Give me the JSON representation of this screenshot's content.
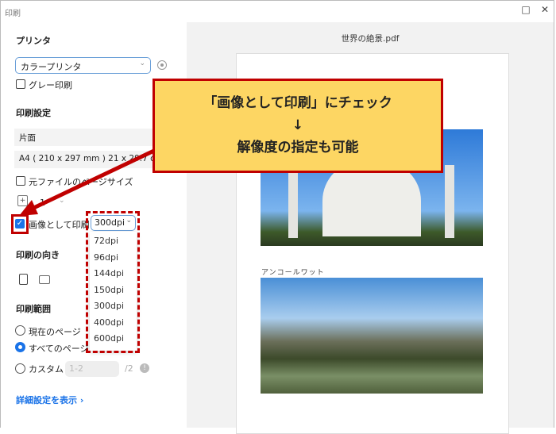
{
  "window": {
    "title": "印刷",
    "maximize_icon": "□",
    "close_icon": "✕"
  },
  "printer": {
    "heading": "プリンタ",
    "selected": "カラープリンタ",
    "gray_print": "グレー印刷"
  },
  "settings": {
    "heading": "印刷設定",
    "duplex": "片面",
    "paper": "A4 ( 210 x 297 mm ) 21 x 29.7 cm",
    "original_size": "元ファイルのページサイズ",
    "copies": "1",
    "print_as_image": "画像として印刷",
    "dpi_selected": "300dpi",
    "dpi_options": [
      "72dpi",
      "96dpi",
      "144dpi",
      "150dpi",
      "300dpi",
      "400dpi",
      "600dpi"
    ]
  },
  "orientation": {
    "heading": "印刷の向き"
  },
  "range": {
    "heading": "印刷範囲",
    "current": "現在のページ",
    "all": "すべてのページ",
    "custom": "カスタム",
    "custom_placeholder": "1-2",
    "total": "/2"
  },
  "advanced_link": "詳細設定を表示 ›",
  "preview": {
    "filename": "世界の絶景.pdf",
    "caption": "アンコールワット"
  },
  "callout": {
    "line1": "「画像として印刷」にチェック",
    "line2": "↓",
    "line3": "解像度の指定も可能"
  }
}
